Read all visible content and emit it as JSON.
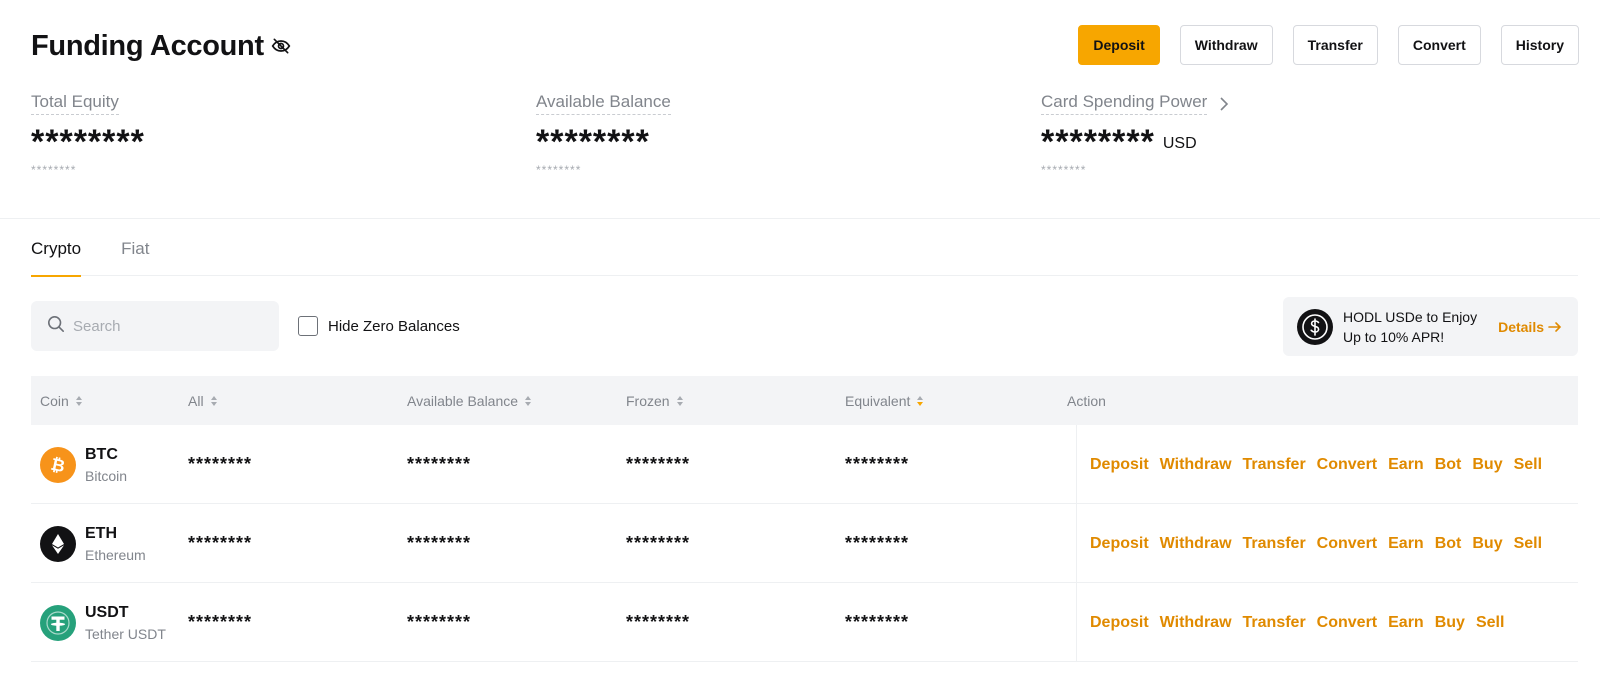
{
  "header": {
    "title": "Funding Account"
  },
  "top_actions": [
    {
      "label": "Deposit",
      "primary": true
    },
    {
      "label": "Withdraw",
      "primary": false
    },
    {
      "label": "Transfer",
      "primary": false
    },
    {
      "label": "Convert",
      "primary": false
    },
    {
      "label": "History",
      "primary": false
    }
  ],
  "stats": {
    "total_equity": {
      "label": "Total Equity",
      "value": "********",
      "sub": "********"
    },
    "available_balance": {
      "label": "Available Balance",
      "value": "********",
      "sub": "********"
    },
    "card_spending_power": {
      "label": "Card Spending Power",
      "value": "********",
      "unit": "USD",
      "sub": "********"
    }
  },
  "tabs": [
    {
      "label": "Crypto",
      "active": true
    },
    {
      "label": "Fiat",
      "active": false
    }
  ],
  "search": {
    "placeholder": "Search"
  },
  "filters": {
    "hide_zero_label": "Hide Zero Balances"
  },
  "promo": {
    "text_line1": "HODL USDe to Enjoy",
    "text_line2": "Up to 10% APR!",
    "link": "Details"
  },
  "table": {
    "headers": {
      "coin": "Coin",
      "all": "All",
      "available": "Available Balance",
      "frozen": "Frozen",
      "equivalent": "Equivalent",
      "action": "Action"
    },
    "rows": [
      {
        "symbol": "BTC",
        "name": "Bitcoin",
        "icon": "bitcoin-icon",
        "all": "********",
        "available": "********",
        "frozen": "********",
        "equivalent": "********",
        "actions": [
          "Deposit",
          "Withdraw",
          "Transfer",
          "Convert",
          "Earn",
          "Bot",
          "Buy",
          "Sell"
        ]
      },
      {
        "symbol": "ETH",
        "name": "Ethereum",
        "icon": "ethereum-icon",
        "all": "********",
        "available": "********",
        "frozen": "********",
        "equivalent": "********",
        "actions": [
          "Deposit",
          "Withdraw",
          "Transfer",
          "Convert",
          "Earn",
          "Bot",
          "Buy",
          "Sell"
        ]
      },
      {
        "symbol": "USDT",
        "name": "Tether USDT",
        "icon": "tether-icon",
        "all": "********",
        "available": "********",
        "frozen": "********",
        "equivalent": "********",
        "actions": [
          "Deposit",
          "Withdraw",
          "Transfer",
          "Convert",
          "Earn",
          "Buy",
          "Sell"
        ]
      }
    ]
  },
  "colors": {
    "accent": "#f7a600",
    "link": "#e08a00",
    "btc": "#f7931a",
    "eth": "#121214",
    "usdt": "#26a17b"
  }
}
